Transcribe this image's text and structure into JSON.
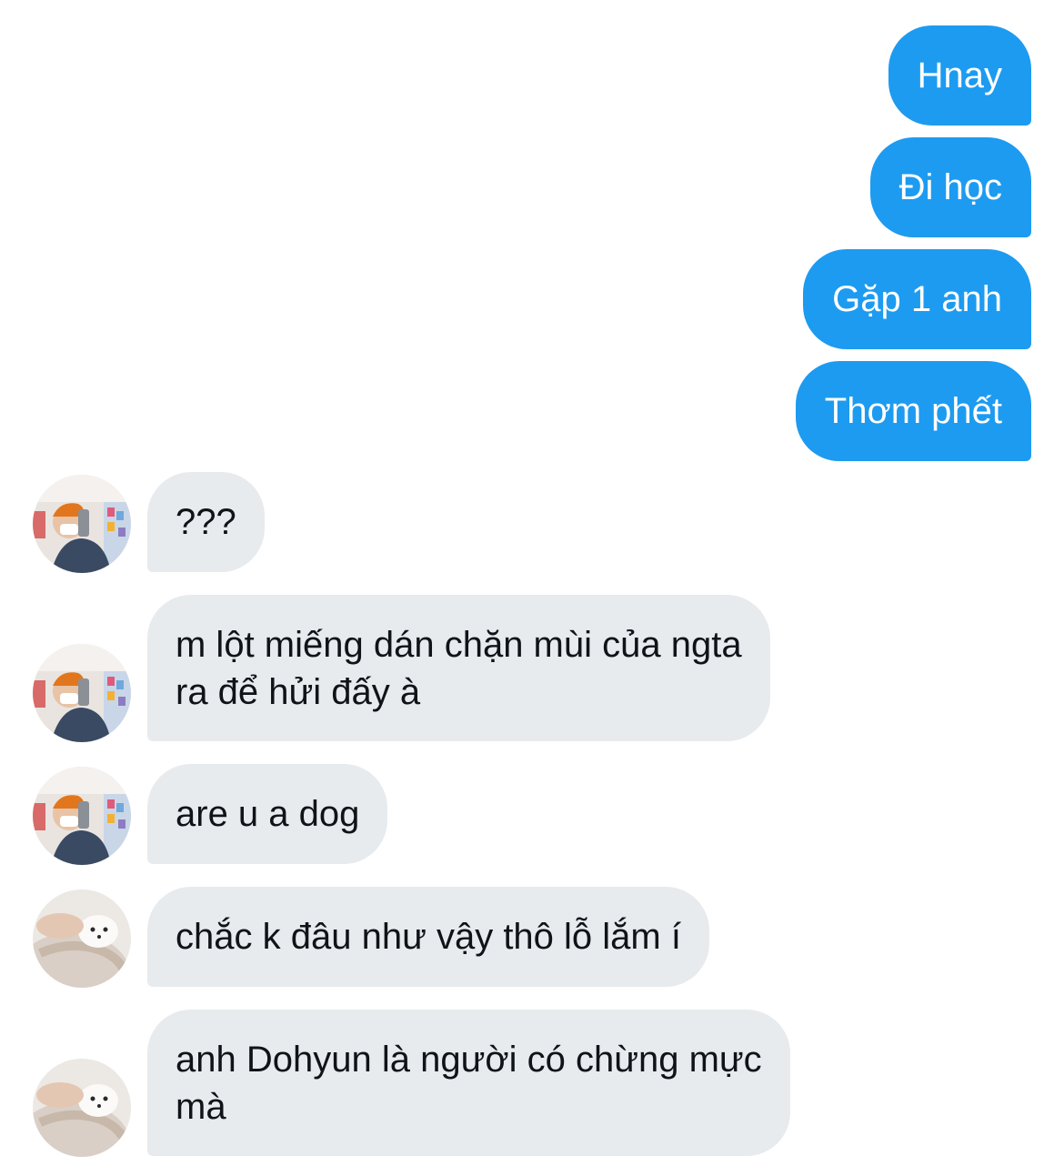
{
  "conversation": {
    "outgoing": [
      {
        "text": "Hnay"
      },
      {
        "text": "Đi học"
      },
      {
        "text": "Gặp 1 anh"
      },
      {
        "text": "Thơm phết"
      }
    ],
    "incoming": [
      {
        "text": "???",
        "avatar": "boy-selfie-avatar"
      },
      {
        "text": "m lột miếng dán chặn mùi của ngta\nra để hửi đấy à",
        "avatar": "boy-selfie-avatar"
      },
      {
        "text": "are u a dog",
        "avatar": "boy-selfie-avatar"
      },
      {
        "text": "chắc k đâu như vậy thô lỗ lắm í",
        "avatar": "puppy-avatar"
      },
      {
        "text": "anh Dohyun là người có chừng mực\nmà",
        "avatar": "puppy-avatar"
      }
    ]
  },
  "colors": {
    "outgoing_bubble": "#1d9bf0",
    "incoming_bubble": "#e7ebee",
    "incoming_text": "#0f1419",
    "outgoing_text": "#ffffff"
  }
}
